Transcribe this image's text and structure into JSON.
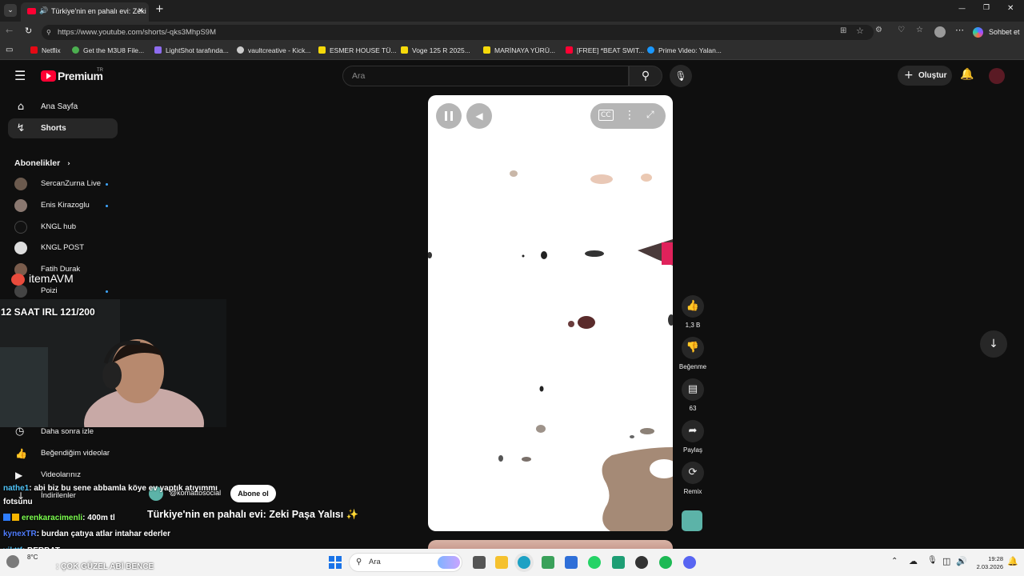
{
  "browser": {
    "tab_title": "Türkiye'nin en pahalı evi: Zeki",
    "url": "https://www.youtube.com/shorts/-qks3MhpS9M",
    "url_host": "www.youtube.com",
    "copilot_label": "Sohbet et",
    "bookmarks": [
      {
        "label": "Netflix",
        "color": "#e50914"
      },
      {
        "label": "Get the M3U8 File...",
        "color": "#4caf50"
      },
      {
        "label": "LightShot tarafında...",
        "color": "#8e6cef"
      },
      {
        "label": "vaultcreative - Kick...",
        "color": "#cccccc"
      },
      {
        "label": "ESMER HOUSE TÜ...",
        "color": "#f5d90a"
      },
      {
        "label": "Voge 125 R 2025...",
        "color": "#f5d90a"
      },
      {
        "label": "MARİNAYA YÜRÜ...",
        "color": "#f5d90a"
      },
      {
        "label": "[FREE] *BEAT SWIT...",
        "color": "#ff0033"
      },
      {
        "label": "Prime Video: Yalan...",
        "color": "#1a98ff"
      }
    ]
  },
  "youtube": {
    "logo": "Premium",
    "logo_sup": "TR",
    "search_placeholder": "Ara",
    "create_label": "Oluştur",
    "nav": {
      "home": "Ana Sayfa",
      "shorts": "Shorts"
    },
    "subscriptions_title": "Abonelikler",
    "subscriptions": [
      {
        "name": "SercanZurna Live",
        "dot": true,
        "color": "#6b5a4e"
      },
      {
        "name": "Enis Kirazoglu",
        "dot": true,
        "color": "#8a7870"
      },
      {
        "name": "KNGL hub",
        "dot": false,
        "color": "#111111"
      },
      {
        "name": "KNGL POST",
        "dot": false,
        "color": "#dddddd"
      },
      {
        "name": "Fatih Durak",
        "dot": false,
        "color": "#7a5c4c"
      },
      {
        "name": "Poizi",
        "dot": true,
        "color": "#444444"
      }
    ],
    "library": {
      "watch_later": "Daha sonra izle",
      "liked": "Beğendiğim videolar",
      "your_videos": "Videolarınız",
      "downloads": "İndirilenler"
    },
    "short": {
      "channel": "@komattosocial",
      "subscribe": "Abone ol",
      "title": "Türkiye'nin en pahalı evi: Zeki Paşa Yalısı ✨",
      "likes": "1,3 B",
      "dislike": "Beğenme",
      "comments": "63",
      "share": "Paylaş",
      "remix": "Remix"
    }
  },
  "overlay": {
    "sponsor_logo": "itemAVM",
    "stream_title": "12 SAAT IRL 121/200",
    "chat": [
      {
        "user": "nathe1",
        "text": ": abi biz bu sene abbamla köye ev yaptık atıyımmı",
        "color": "#4fc3f7"
      },
      {
        "user": "",
        "text": "fotsunu",
        "color": "#ffffff"
      },
      {
        "user": "erenkaracimenli",
        "text": ": 400m tl",
        "color": "#7cff4f"
      },
      {
        "user": "kynexTR",
        "text": ": burdan çatıya atlar intahar ederler",
        "color": "#4f7dff"
      },
      {
        "user": "yikttf",
        "text": ": BERBAT",
        "color": "#4fc3f7"
      },
      {
        "user": "",
        "text": ": ÇOK GÜZEL ABİ BENCE",
        "color": "#ff4040"
      }
    ]
  },
  "taskbar": {
    "search": "Ara",
    "weather": "8°C",
    "time": "19:28",
    "date": "2.03.2026"
  }
}
